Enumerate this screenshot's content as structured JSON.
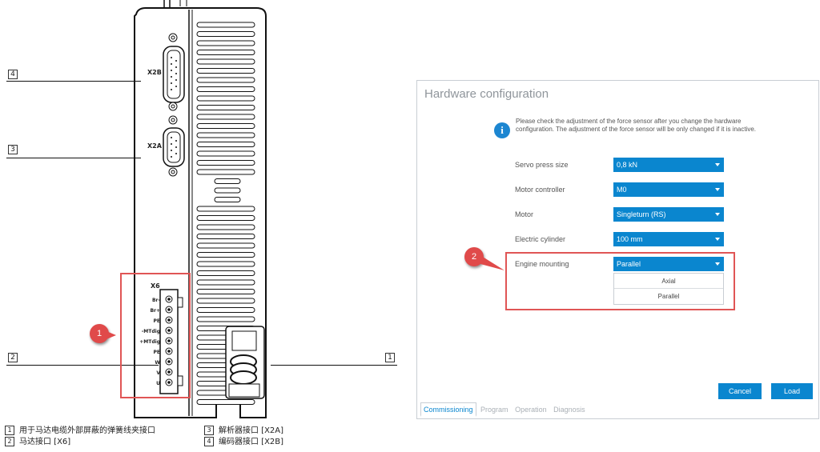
{
  "drawing": {
    "connectors": {
      "x2b": "X2B",
      "x2a": "X2A",
      "x6": "X6"
    },
    "x6_pins": [
      "Br-",
      "Br+",
      "PE",
      "-MTdig",
      "+MTdig",
      "PE",
      "W",
      "V",
      "U"
    ],
    "markers": {
      "m4": "4",
      "m3": "3",
      "m2": "2",
      "m1": "1"
    },
    "callout_1": "1",
    "legend": [
      {
        "num": "1",
        "text": "用于马达电缆外部屏蔽的弹簧线夹接口"
      },
      {
        "num": "2",
        "text": "马达接口 [X6]"
      },
      {
        "num": "3",
        "text": "解析器接口 [X2A]"
      },
      {
        "num": "4",
        "text": "编码器接口 [X2B]"
      }
    ]
  },
  "app": {
    "title": "Hardware configuration",
    "info_icon": "info-icon",
    "info_text": "Please check the adjustment of the force sensor after you change the hardware configuration. The adjustment of the force sensor will be only changed if it is inactive.",
    "fields": [
      {
        "label": "Servo press size",
        "value": "0,8 kN"
      },
      {
        "label": "Motor controller",
        "value": "M0"
      },
      {
        "label": "Motor",
        "value": "Singleturn (RS)"
      },
      {
        "label": "Electric cylinder",
        "value": "100 mm"
      },
      {
        "label": "Engine mounting",
        "value": "Parallel"
      }
    ],
    "dropdown_options": [
      "Axial",
      "Parallel"
    ],
    "callout_2": "2",
    "buttons": {
      "cancel": "Cancel",
      "load": "Load"
    },
    "tabs": [
      "Commissioning",
      "Program",
      "Operation",
      "Diagnosis"
    ],
    "colors": {
      "accent": "#0a86cf",
      "highlight": "#e05555",
      "info": "#1c86d1"
    }
  }
}
